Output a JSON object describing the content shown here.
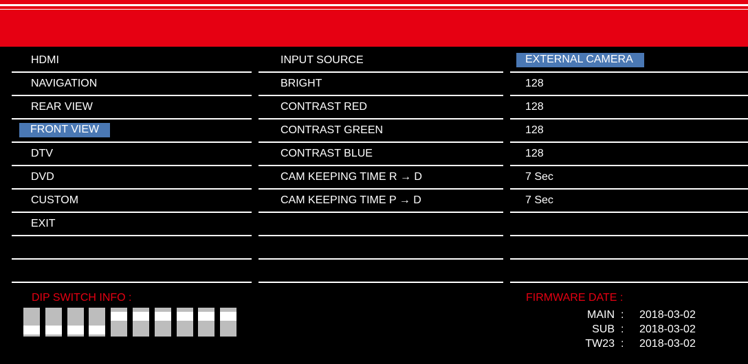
{
  "colors": {
    "header": "#e60012",
    "selection": "#4a78b4",
    "dip_off": "#bdbdbd",
    "dip_knob": "#ffffff"
  },
  "menu": {
    "items": [
      {
        "label": "HDMI",
        "selected": false
      },
      {
        "label": "NAVIGATION",
        "selected": false
      },
      {
        "label": "REAR VIEW",
        "selected": false
      },
      {
        "label": "FRONT VIEW",
        "selected": true
      },
      {
        "label": "DTV",
        "selected": false
      },
      {
        "label": "DVD",
        "selected": false
      },
      {
        "label": "CUSTOM",
        "selected": false
      },
      {
        "label": "EXIT",
        "selected": false
      }
    ]
  },
  "settings": {
    "rows": [
      {
        "label": "INPUT SOURCE",
        "value": "EXTERNAL CAMERA",
        "value_selected": true
      },
      {
        "label": "BRIGHT",
        "value": "128",
        "value_selected": false
      },
      {
        "label": "CONTRAST RED",
        "value": "128",
        "value_selected": false
      },
      {
        "label": "CONTRAST GREEN",
        "value": "128",
        "value_selected": false
      },
      {
        "label": "CONTRAST BLUE",
        "value": "128",
        "value_selected": false
      },
      {
        "label": "CAM KEEPING TIME R → D",
        "value": "7 Sec",
        "value_selected": false
      },
      {
        "label": "CAM KEEPING TIME P → D",
        "value": "7 Sec",
        "value_selected": false
      }
    ]
  },
  "dip": {
    "title": "DIP SWITCH INFO :",
    "switches": [
      "down",
      "down",
      "down",
      "down",
      "up",
      "up",
      "up",
      "up",
      "up",
      "up"
    ]
  },
  "firmware": {
    "title": "FIRMWARE DATE :",
    "entries": [
      {
        "label": "MAIN",
        "sep": ":",
        "date": "2018-03-02"
      },
      {
        "label": "SUB",
        "sep": ":",
        "date": "2018-03-02"
      },
      {
        "label": "TW23",
        "sep": ":",
        "date": "2018-03-02"
      }
    ]
  }
}
